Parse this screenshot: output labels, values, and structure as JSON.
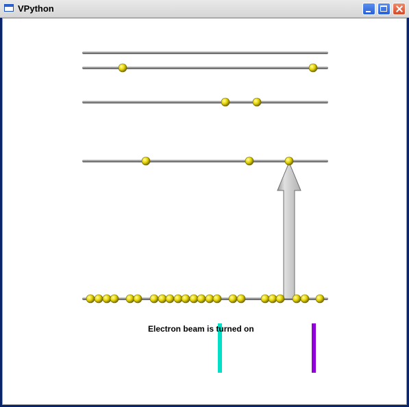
{
  "window": {
    "title": "VPython",
    "status_text": "Electron beam is turned on"
  },
  "scene": {
    "level_color": "#8c8c8c",
    "electron_color": "#ffee00",
    "arrow_color": "#bdbdbd",
    "spectral_lines": [
      {
        "name": "cyan-line",
        "color": "#00e0c8"
      },
      {
        "name": "violet-line",
        "color": "#9000d8"
      }
    ]
  }
}
